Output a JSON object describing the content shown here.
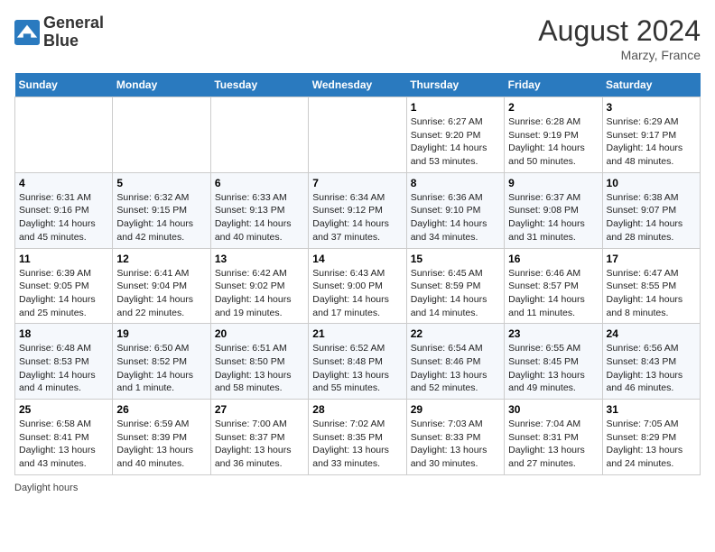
{
  "header": {
    "logo_line1": "General",
    "logo_line2": "Blue",
    "month_year": "August 2024",
    "location": "Marzy, France"
  },
  "days_of_week": [
    "Sunday",
    "Monday",
    "Tuesday",
    "Wednesday",
    "Thursday",
    "Friday",
    "Saturday"
  ],
  "weeks": [
    [
      {
        "day": "",
        "sunrise": "",
        "sunset": "",
        "daylight": ""
      },
      {
        "day": "",
        "sunrise": "",
        "sunset": "",
        "daylight": ""
      },
      {
        "day": "",
        "sunrise": "",
        "sunset": "",
        "daylight": ""
      },
      {
        "day": "",
        "sunrise": "",
        "sunset": "",
        "daylight": ""
      },
      {
        "day": "1",
        "sunrise": "Sunrise: 6:27 AM",
        "sunset": "Sunset: 9:20 PM",
        "daylight": "Daylight: 14 hours and 53 minutes."
      },
      {
        "day": "2",
        "sunrise": "Sunrise: 6:28 AM",
        "sunset": "Sunset: 9:19 PM",
        "daylight": "Daylight: 14 hours and 50 minutes."
      },
      {
        "day": "3",
        "sunrise": "Sunrise: 6:29 AM",
        "sunset": "Sunset: 9:17 PM",
        "daylight": "Daylight: 14 hours and 48 minutes."
      }
    ],
    [
      {
        "day": "4",
        "sunrise": "Sunrise: 6:31 AM",
        "sunset": "Sunset: 9:16 PM",
        "daylight": "Daylight: 14 hours and 45 minutes."
      },
      {
        "day": "5",
        "sunrise": "Sunrise: 6:32 AM",
        "sunset": "Sunset: 9:15 PM",
        "daylight": "Daylight: 14 hours and 42 minutes."
      },
      {
        "day": "6",
        "sunrise": "Sunrise: 6:33 AM",
        "sunset": "Sunset: 9:13 PM",
        "daylight": "Daylight: 14 hours and 40 minutes."
      },
      {
        "day": "7",
        "sunrise": "Sunrise: 6:34 AM",
        "sunset": "Sunset: 9:12 PM",
        "daylight": "Daylight: 14 hours and 37 minutes."
      },
      {
        "day": "8",
        "sunrise": "Sunrise: 6:36 AM",
        "sunset": "Sunset: 9:10 PM",
        "daylight": "Daylight: 14 hours and 34 minutes."
      },
      {
        "day": "9",
        "sunrise": "Sunrise: 6:37 AM",
        "sunset": "Sunset: 9:08 PM",
        "daylight": "Daylight: 14 hours and 31 minutes."
      },
      {
        "day": "10",
        "sunrise": "Sunrise: 6:38 AM",
        "sunset": "Sunset: 9:07 PM",
        "daylight": "Daylight: 14 hours and 28 minutes."
      }
    ],
    [
      {
        "day": "11",
        "sunrise": "Sunrise: 6:39 AM",
        "sunset": "Sunset: 9:05 PM",
        "daylight": "Daylight: 14 hours and 25 minutes."
      },
      {
        "day": "12",
        "sunrise": "Sunrise: 6:41 AM",
        "sunset": "Sunset: 9:04 PM",
        "daylight": "Daylight: 14 hours and 22 minutes."
      },
      {
        "day": "13",
        "sunrise": "Sunrise: 6:42 AM",
        "sunset": "Sunset: 9:02 PM",
        "daylight": "Daylight: 14 hours and 19 minutes."
      },
      {
        "day": "14",
        "sunrise": "Sunrise: 6:43 AM",
        "sunset": "Sunset: 9:00 PM",
        "daylight": "Daylight: 14 hours and 17 minutes."
      },
      {
        "day": "15",
        "sunrise": "Sunrise: 6:45 AM",
        "sunset": "Sunset: 8:59 PM",
        "daylight": "Daylight: 14 hours and 14 minutes."
      },
      {
        "day": "16",
        "sunrise": "Sunrise: 6:46 AM",
        "sunset": "Sunset: 8:57 PM",
        "daylight": "Daylight: 14 hours and 11 minutes."
      },
      {
        "day": "17",
        "sunrise": "Sunrise: 6:47 AM",
        "sunset": "Sunset: 8:55 PM",
        "daylight": "Daylight: 14 hours and 8 minutes."
      }
    ],
    [
      {
        "day": "18",
        "sunrise": "Sunrise: 6:48 AM",
        "sunset": "Sunset: 8:53 PM",
        "daylight": "Daylight: 14 hours and 4 minutes."
      },
      {
        "day": "19",
        "sunrise": "Sunrise: 6:50 AM",
        "sunset": "Sunset: 8:52 PM",
        "daylight": "Daylight: 14 hours and 1 minute."
      },
      {
        "day": "20",
        "sunrise": "Sunrise: 6:51 AM",
        "sunset": "Sunset: 8:50 PM",
        "daylight": "Daylight: 13 hours and 58 minutes."
      },
      {
        "day": "21",
        "sunrise": "Sunrise: 6:52 AM",
        "sunset": "Sunset: 8:48 PM",
        "daylight": "Daylight: 13 hours and 55 minutes."
      },
      {
        "day": "22",
        "sunrise": "Sunrise: 6:54 AM",
        "sunset": "Sunset: 8:46 PM",
        "daylight": "Daylight: 13 hours and 52 minutes."
      },
      {
        "day": "23",
        "sunrise": "Sunrise: 6:55 AM",
        "sunset": "Sunset: 8:45 PM",
        "daylight": "Daylight: 13 hours and 49 minutes."
      },
      {
        "day": "24",
        "sunrise": "Sunrise: 6:56 AM",
        "sunset": "Sunset: 8:43 PM",
        "daylight": "Daylight: 13 hours and 46 minutes."
      }
    ],
    [
      {
        "day": "25",
        "sunrise": "Sunrise: 6:58 AM",
        "sunset": "Sunset: 8:41 PM",
        "daylight": "Daylight: 13 hours and 43 minutes."
      },
      {
        "day": "26",
        "sunrise": "Sunrise: 6:59 AM",
        "sunset": "Sunset: 8:39 PM",
        "daylight": "Daylight: 13 hours and 40 minutes."
      },
      {
        "day": "27",
        "sunrise": "Sunrise: 7:00 AM",
        "sunset": "Sunset: 8:37 PM",
        "daylight": "Daylight: 13 hours and 36 minutes."
      },
      {
        "day": "28",
        "sunrise": "Sunrise: 7:02 AM",
        "sunset": "Sunset: 8:35 PM",
        "daylight": "Daylight: 13 hours and 33 minutes."
      },
      {
        "day": "29",
        "sunrise": "Sunrise: 7:03 AM",
        "sunset": "Sunset: 8:33 PM",
        "daylight": "Daylight: 13 hours and 30 minutes."
      },
      {
        "day": "30",
        "sunrise": "Sunrise: 7:04 AM",
        "sunset": "Sunset: 8:31 PM",
        "daylight": "Daylight: 13 hours and 27 minutes."
      },
      {
        "day": "31",
        "sunrise": "Sunrise: 7:05 AM",
        "sunset": "Sunset: 8:29 PM",
        "daylight": "Daylight: 13 hours and 24 minutes."
      }
    ]
  ],
  "footer": {
    "daylight_label": "Daylight hours"
  }
}
